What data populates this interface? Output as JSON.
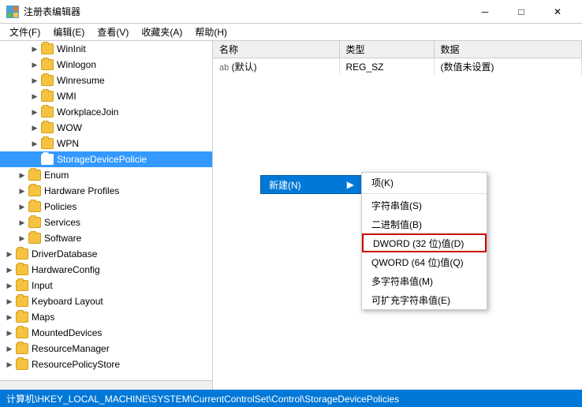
{
  "window": {
    "title": "注册表编辑器",
    "icon": "regedit-icon"
  },
  "titlebar": {
    "minimize": "─",
    "maximize": "□",
    "close": "✕"
  },
  "menubar": {
    "items": [
      "文件(F)",
      "编辑(E)",
      "查看(V)",
      "收藏夹(A)",
      "帮助(H)"
    ]
  },
  "tree": {
    "items": [
      {
        "label": "WinInit",
        "indent": 2,
        "expander": "collapsed"
      },
      {
        "label": "Winlogon",
        "indent": 2,
        "expander": "collapsed"
      },
      {
        "label": "Winresume",
        "indent": 2,
        "expander": "collapsed"
      },
      {
        "label": "WMI",
        "indent": 2,
        "expander": "collapsed"
      },
      {
        "label": "WorkplaceJoin",
        "indent": 2,
        "expander": "collapsed"
      },
      {
        "label": "WOW",
        "indent": 2,
        "expander": "collapsed"
      },
      {
        "label": "WPN",
        "indent": 2,
        "expander": "collapsed"
      },
      {
        "label": "StorageDevicePolicie",
        "indent": 2,
        "expander": "empty",
        "selected": true,
        "open": true
      },
      {
        "label": "Enum",
        "indent": 1,
        "expander": "collapsed"
      },
      {
        "label": "Hardware Profiles",
        "indent": 1,
        "expander": "collapsed"
      },
      {
        "label": "Policies",
        "indent": 1,
        "expander": "collapsed"
      },
      {
        "label": "Services",
        "indent": 1,
        "expander": "collapsed"
      },
      {
        "label": "Software",
        "indent": 1,
        "expander": "collapsed"
      },
      {
        "label": "DriverDatabase",
        "indent": 0,
        "expander": "collapsed"
      },
      {
        "label": "HardwareConfig",
        "indent": 0,
        "expander": "collapsed"
      },
      {
        "label": "Input",
        "indent": 0,
        "expander": "collapsed"
      },
      {
        "label": "Keyboard Layout",
        "indent": 0,
        "expander": "collapsed"
      },
      {
        "label": "Maps",
        "indent": 0,
        "expander": "collapsed"
      },
      {
        "label": "MountedDevices",
        "indent": 0,
        "expander": "collapsed"
      },
      {
        "label": "ResourceManager",
        "indent": 0,
        "expander": "collapsed"
      },
      {
        "label": "ResourcePolicyStore",
        "indent": 0,
        "expander": "collapsed"
      }
    ]
  },
  "table": {
    "columns": [
      "名称",
      "类型",
      "数据"
    ],
    "rows": [
      {
        "name": "(默认)",
        "type": "REG_SZ",
        "data": "(数值未设置)"
      }
    ]
  },
  "context_menu": {
    "new_label": "新建(N)",
    "arrow": "▶",
    "items": [
      {
        "label": "项(K)",
        "highlighted": false
      },
      {
        "label": "字符串值(S)",
        "highlighted": false
      },
      {
        "label": "二进制值(B)",
        "highlighted": false
      },
      {
        "label": "DWORD (32 位)值(D)",
        "highlighted": true
      },
      {
        "label": "QWORD (64 位)值(Q)",
        "highlighted": false
      },
      {
        "label": "多字符串值(M)",
        "highlighted": false
      },
      {
        "label": "可扩充字符串值(E)",
        "highlighted": false
      }
    ]
  },
  "status_bar": {
    "path": "计算机\\HKEY_LOCAL_MACHINE\\SYSTEM\\CurrentControlSet\\Control\\StorageDevicePolicies"
  }
}
